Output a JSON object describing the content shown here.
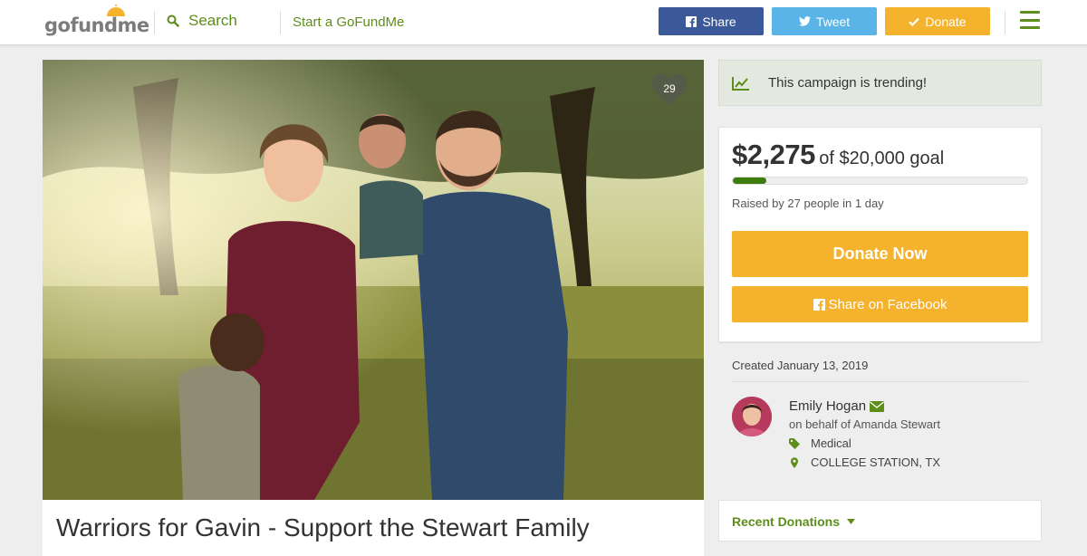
{
  "brand": {
    "logo_text_a": "go",
    "logo_text_b": "fund",
    "logo_text_c": "me",
    "accent": "#5d8d1a",
    "donate_color": "#f5b22d"
  },
  "header": {
    "search_label": "Search",
    "start_link": "Start a GoFundMe",
    "share_label": "Share",
    "tweet_label": "Tweet",
    "donate_label": "Donate"
  },
  "campaign": {
    "title": "Warriors for Gavin - Support the Stewart Family",
    "heart_count": "29",
    "trending_text": "This campaign is trending!",
    "raised_amount": "$2,275",
    "goal_text": "of $20,000 goal",
    "progress_fraction": 0.11375,
    "raised_by": "Raised by 27 people in 1 day",
    "donate_now": "Donate Now",
    "share_facebook": "Share on Facebook",
    "created": "Created January 13, 2019",
    "organizer_name": "Emily Hogan",
    "on_behalf": "on behalf of Amanda Stewart",
    "category": "Medical",
    "location": "COLLEGE STATION, TX",
    "recent_donations": "Recent Donations"
  }
}
